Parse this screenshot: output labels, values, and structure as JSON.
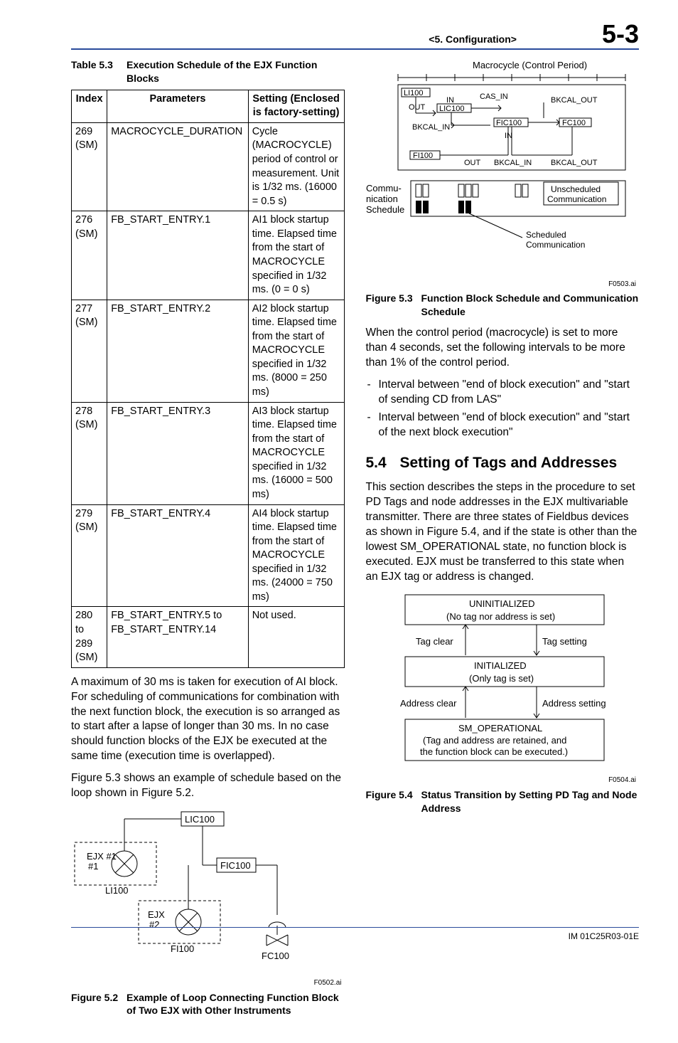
{
  "header": {
    "breadcrumb": "<5.  Configuration>",
    "pagenum": "5-3"
  },
  "table_caption": {
    "num": "Table 5.3",
    "title": "Execution Schedule of the EJX Function Blocks"
  },
  "table": {
    "headers": [
      "Index",
      "Parameters",
      "Setting (Enclosed is factory-setting)"
    ],
    "rows": [
      [
        "269 (SM)",
        "MACROCYCLE_DURATION",
        "Cycle (MACROCYCLE) period of control or measurement. Unit is 1/32 ms. (16000 = 0.5 s)"
      ],
      [
        "276 (SM)",
        "FB_START_ENTRY.1",
        "AI1 block startup time. Elapsed time from the start of MACROCYCLE specified in 1/32 ms. (0 = 0 s)"
      ],
      [
        "277 (SM)",
        "FB_START_ENTRY.2",
        "AI2 block startup time. Elapsed time from the start of MACROCYCLE specified in 1/32 ms. (8000 = 250 ms)"
      ],
      [
        "278 (SM)",
        "FB_START_ENTRY.3",
        "AI3 block startup time. Elapsed time from the start of MACROCYCLE specified in 1/32 ms. (16000 = 500 ms)"
      ],
      [
        "279 (SM)",
        "FB_START_ENTRY.4",
        "AI4 block startup time. Elapsed time from the start of MACROCYCLE specified in 1/32 ms. (24000 = 750 ms)"
      ],
      [
        "280 to 289 (SM)",
        "FB_START_ENTRY.5 to FB_START_ENTRY.14",
        "Not used."
      ]
    ]
  },
  "left_paras": {
    "p1": "A maximum of 30 ms is taken for execution of AI block. For scheduling of communications for combination with the next function block, the execution is so arranged as to start after a lapse of longer than 30 ms. In no case should function blocks of the EJX be executed at the same time (execution time is overlapped).",
    "p2": "Figure 5.3 shows an example of schedule based on the loop shown in Figure 5.2."
  },
  "fig52": {
    "num": "Figure 5.2",
    "title": "Example of Loop Connecting Function Block of Two EJX with Other Instruments",
    "ai": "F0502.ai",
    "labels": {
      "ejx1": "EJX #1",
      "ejx2": "EJX #2",
      "li100": "LI100",
      "lic100": "LIC100",
      "fic100": "FIC100",
      "fi100": "FI100",
      "fc100": "FC100"
    }
  },
  "fig53": {
    "num": "Figure 5.3",
    "title": "Function Block Schedule and Communication Schedule",
    "ai": "F0503.ai",
    "labels": {
      "macro": "Macrocycle (Control Period)",
      "li100": "LI100",
      "lic100": "LIC100",
      "fic100": "FIC100",
      "fc100": "FC100",
      "fi100": "FI100",
      "out1": "OUT",
      "in1": "IN",
      "cas_in": "CAS_IN",
      "bkcal_out": "BKCAL_OUT",
      "bkcal_in1": "BKCAL_IN",
      "in2": "IN",
      "out2": "OUT",
      "bkcal_in2": "BKCAL_IN",
      "bkcal_out2": "BKCAL_OUT",
      "comm": "Commu-\nnication Schedule",
      "unsched": "Unscheduled Communication",
      "sched": "Scheduled Communication"
    }
  },
  "right_paras": {
    "p1": "When the control period (macrocycle) is set to more than 4 seconds, set the following intervals to be more than 1% of the control period.",
    "li1": "Interval between \"end of block execution\" and \"start of sending CD from LAS\"",
    "li2": "Interval between \"end of block execution\" and \"start of the next block execution\""
  },
  "sec54": {
    "num": "5.4",
    "title": "Setting of Tags and Addresses",
    "p1": "This section describes the steps in the procedure to set PD Tags and node addresses in the EJX multivariable transmitter. There are three states of Fieldbus devices as shown in Figure 5.4, and if the state is other than the lowest SM_OPERATIONAL state, no function block is executed. EJX must be transferred to this state when an EJX tag or address is changed."
  },
  "fig54": {
    "num": "Figure 5.4",
    "title": "Status Transition by Setting PD Tag and Node Address",
    "ai": "F0504.ai",
    "labels": {
      "uninit1": "UNINITIALIZED",
      "uninit2": "(No tag nor address is set)",
      "tagclear": "Tag clear",
      "tagset": "Tag setting",
      "init1": "INITIALIZED",
      "init2": "(Only tag is set)",
      "addrclear": "Address clear",
      "addrset": "Address setting",
      "smop1": "SM_OPERATIONAL",
      "smop2": "(Tag and address are retained, and",
      "smop3": "the function block can be executed.)"
    }
  },
  "footer": "IM 01C25R03-01E"
}
